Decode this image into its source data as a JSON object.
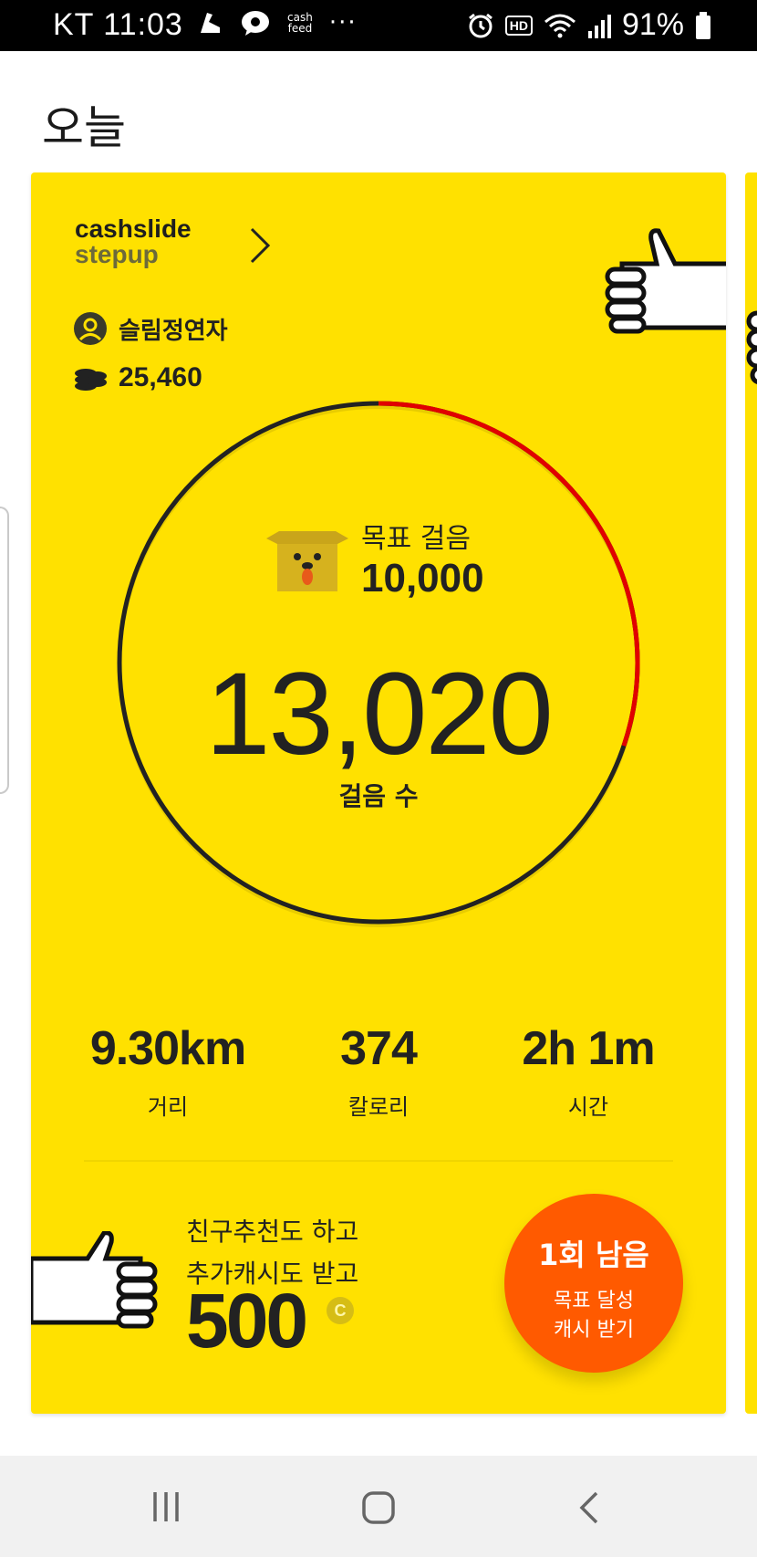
{
  "status_bar": {
    "carrier_time": "KT 11:03",
    "cashfeed_top": "cash",
    "cashfeed_bottom": "feed",
    "more": "···",
    "hd": "HD",
    "battery": "91%"
  },
  "page_title": "오늘",
  "card": {
    "brand_line1": "cashslide",
    "brand_line2": "stepup",
    "user_name": "슬림정연자",
    "coins": "25,460",
    "goal_label": "목표 걸음",
    "goal_value": "10,000",
    "steps_value": "13,020",
    "steps_label": "걸음 수",
    "stats": [
      {
        "value": "9.30km",
        "label": "거리"
      },
      {
        "value": "374",
        "label": "칼로리"
      },
      {
        "value": "2h 1m",
        "label": "시간"
      }
    ],
    "promo_line1": "친구추천도 하고",
    "promo_line2": "추가캐시도 받고",
    "promo_amount": "500",
    "promo_coin_symbol": "C",
    "reward_title": "1회 남음",
    "reward_line1": "목표 달성",
    "reward_line2": "캐시 받기"
  },
  "progress": {
    "steps": 13020,
    "goal": 10000,
    "ring_fraction": 1.0,
    "red_arc_fraction": 0.302
  },
  "colors": {
    "card_bg": "#ffe100",
    "ring_dark": "#222222",
    "ring_red": "#e10000",
    "reward_bg": "#ff5a00"
  }
}
